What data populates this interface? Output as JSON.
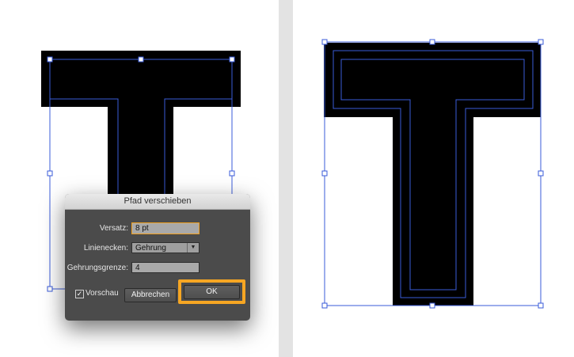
{
  "dialog": {
    "title": "Pfad verschieben",
    "offset_label": "Versatz:",
    "offset_value": "8 pt",
    "corners_label": "Linienecken:",
    "corners_value": "Gehrung",
    "miter_label": "Gehrungsgrenze:",
    "miter_value": "4",
    "preview_label": "Vorschau",
    "preview_checked": true,
    "cancel_label": "Abbrechen",
    "ok_label": "OK"
  },
  "icons": {
    "checkbox": "checkmark-icon",
    "dropdown": "chevron-down-icon"
  },
  "colors": {
    "selection": "#3a5bd9",
    "highlight": "#f6a623",
    "fill": "#000000",
    "dialog_bg": "#4b4b4b"
  }
}
